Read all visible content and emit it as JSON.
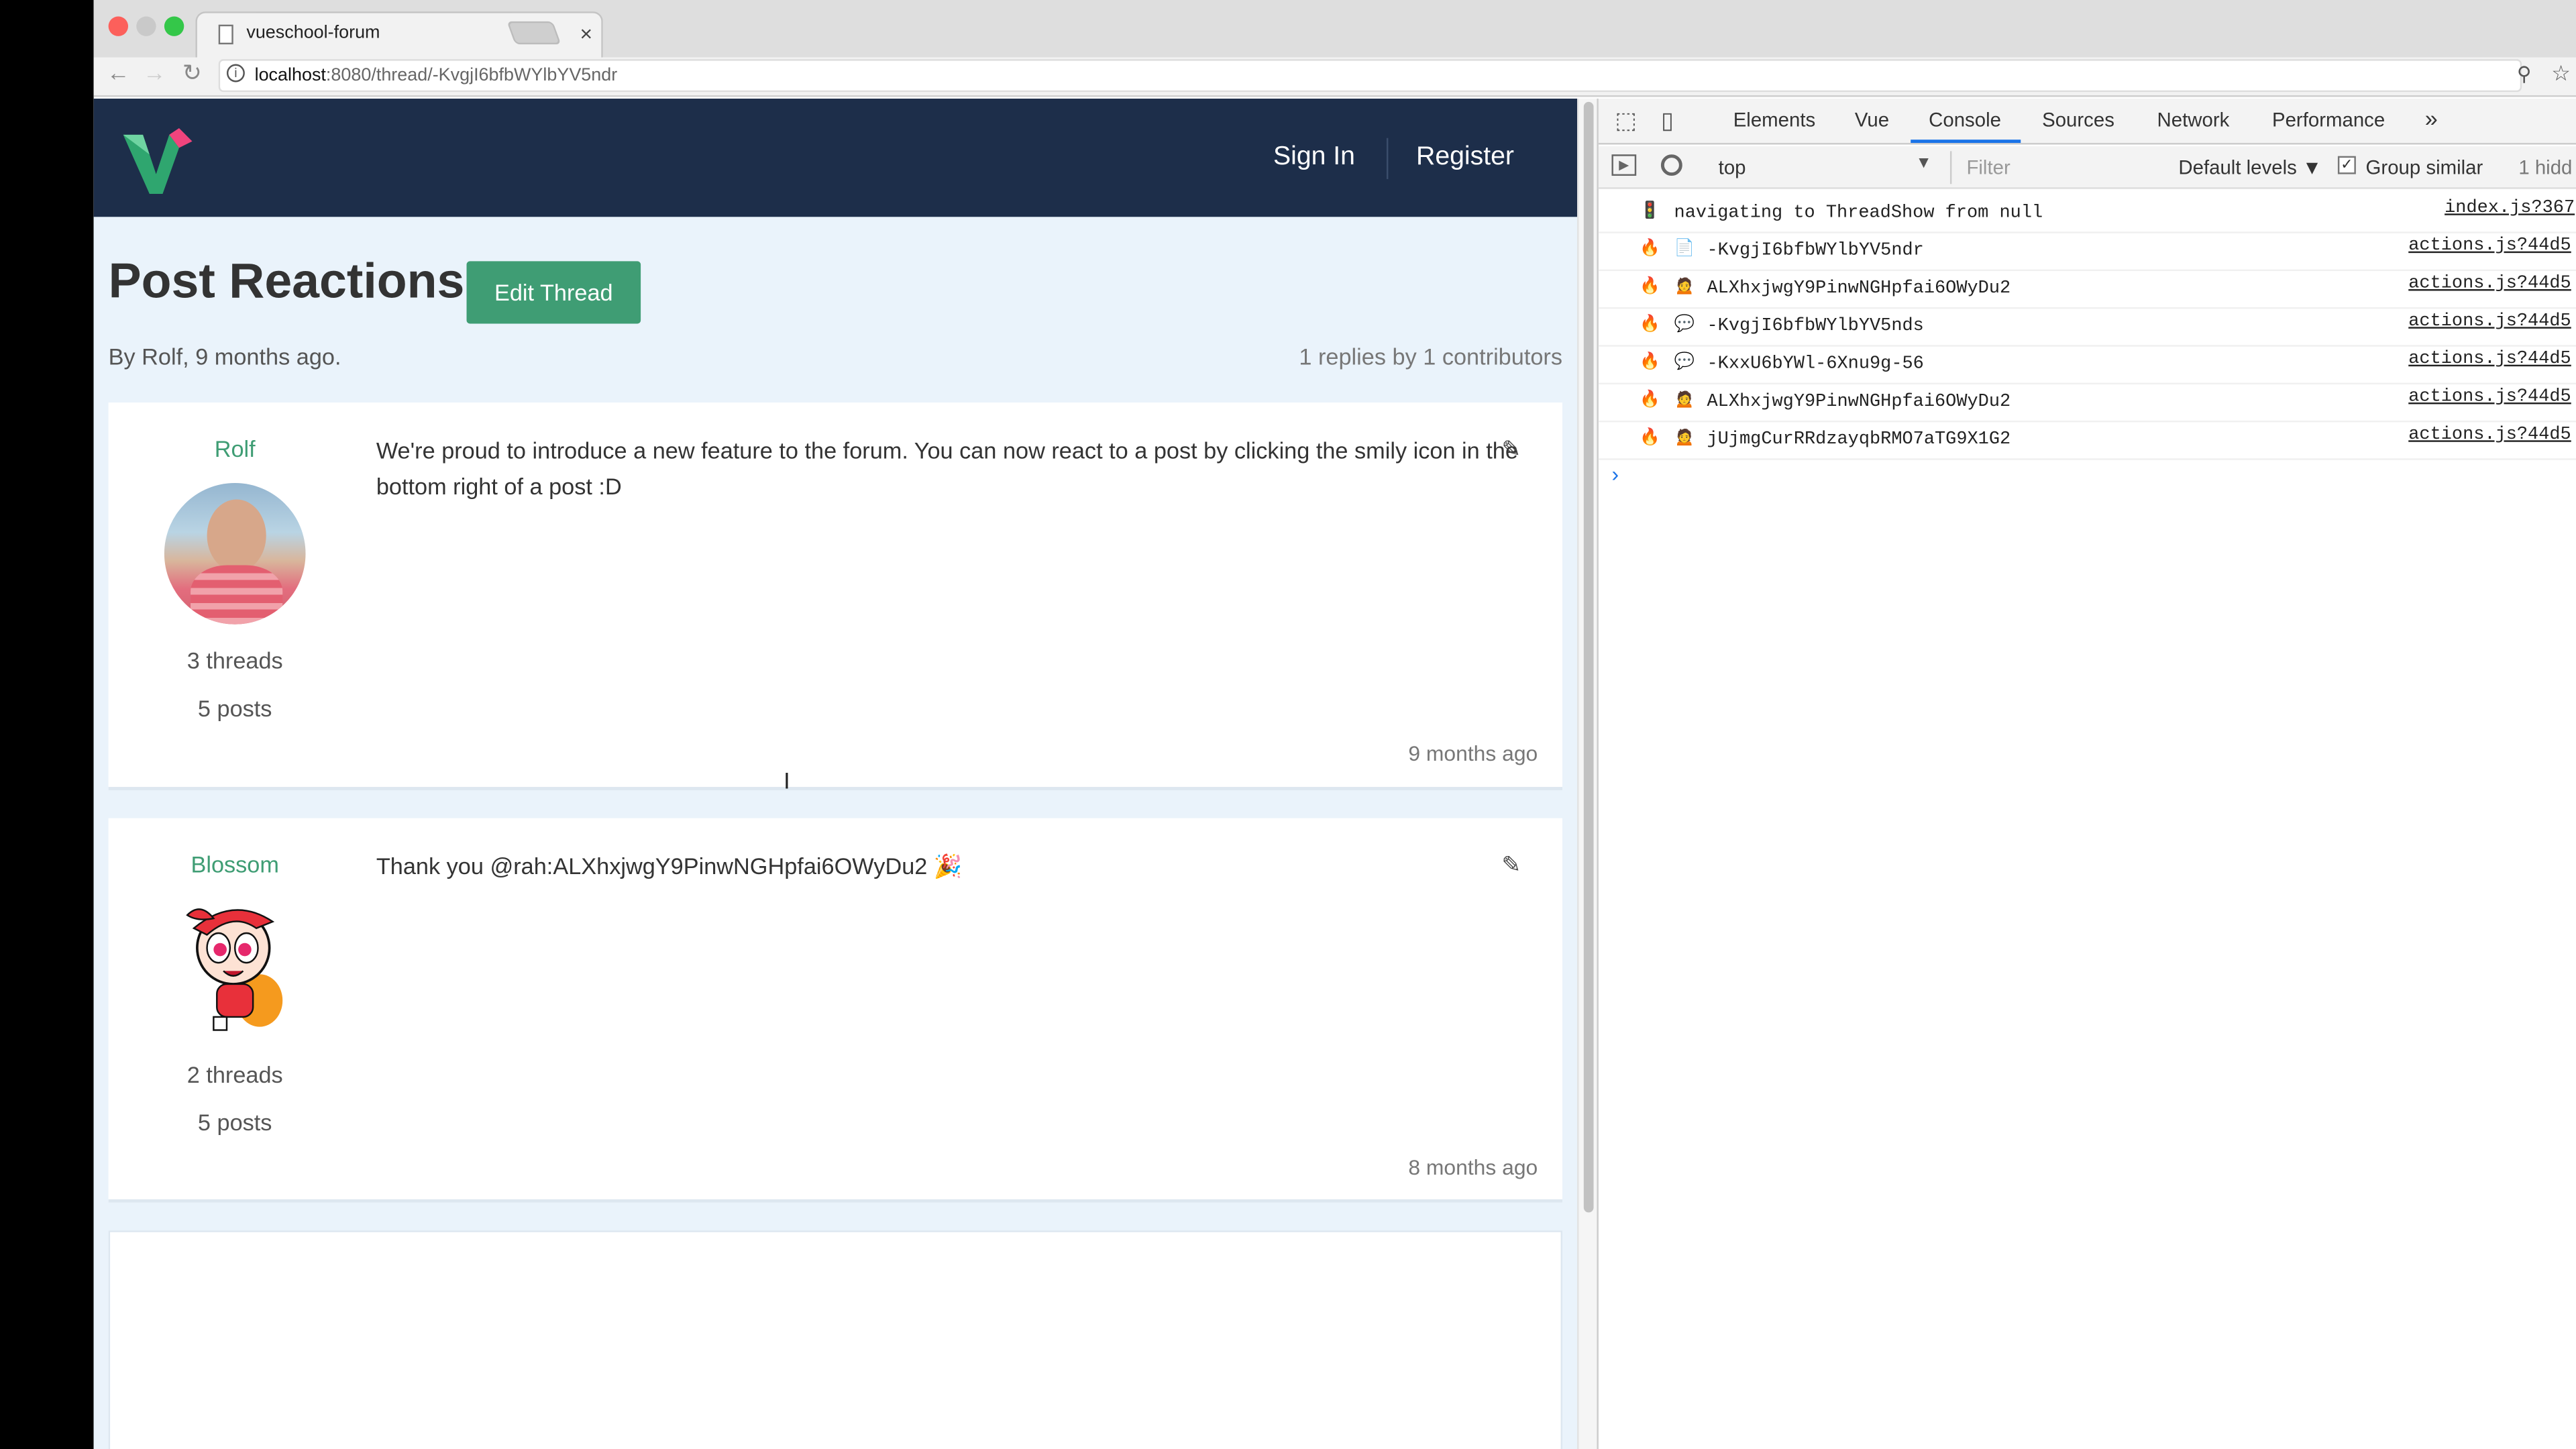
{
  "browser": {
    "tab_title": "vueschool-forum",
    "url_host": "localhost",
    "url_path": ":8080/thread/-KvgjI6bfbWYlbYV5ndr"
  },
  "navbar": {
    "sign_in": "Sign In",
    "register": "Register"
  },
  "thread": {
    "title": "Post Reactions",
    "edit_button": "Edit Thread",
    "byline": "By Rolf, 9 months ago.",
    "replies_summary": "1 replies by 1 contributors"
  },
  "posts": [
    {
      "author": "Rolf",
      "threads": "3 threads",
      "posts": "5 posts",
      "text": "We're proud to introduce a new feature to the forum. You can now react to a post by clicking the smily icon in the bottom right of a post :D",
      "time": "9 months ago"
    },
    {
      "author": "Blossom",
      "threads": "2 threads",
      "posts": "5 posts",
      "text": "Thank you @rah:ALXhxjwgY9PinwNGHpfai6OWyDu2 🎉",
      "time": "8 months ago"
    }
  ],
  "devtools": {
    "tabs": [
      "Elements",
      "Vue",
      "Console",
      "Sources",
      "Network",
      "Performance"
    ],
    "active_tab": "Console",
    "more": "»",
    "context": "top",
    "filter_placeholder": "Filter",
    "levels": "Default levels ▼",
    "group_similar": "Group similar",
    "hidden": "1 hidd",
    "console_rows": [
      {
        "icon": "🚦",
        "icon2": "",
        "message": "navigating to ThreadShow from null",
        "source": "index.js?367"
      },
      {
        "icon": "🔥",
        "icon2": "📄",
        "message": "-KvgjI6bfbWYlbYV5ndr",
        "source": "actions.js?44d5"
      },
      {
        "icon": "🔥",
        "icon2": "🙍",
        "message": "ALXhxjwgY9PinwNGHpfai6OWyDu2",
        "source": "actions.js?44d5"
      },
      {
        "icon": "🔥",
        "icon2": "💬",
        "message": "-KvgjI6bfbWYlbYV5nds",
        "source": "actions.js?44d5"
      },
      {
        "icon": "🔥",
        "icon2": "💬",
        "message": "-KxxU6bYWl-6Xnu9g-56",
        "source": "actions.js?44d5"
      },
      {
        "icon": "🔥",
        "icon2": "🙍",
        "message": "ALXhxjwgY9PinwNGHpfai6OWyDu2",
        "source": "actions.js?44d5"
      },
      {
        "icon": "🔥",
        "icon2": "🙍",
        "message": "jUjmgCurRRdzayqbRMO7aTG9X1G2",
        "source": "actions.js?44d5"
      }
    ],
    "prompt": "›"
  },
  "colors": {
    "navbar": "#1d2e4a",
    "accent": "#3f9d74",
    "page_bg": "#eaf3fb"
  }
}
